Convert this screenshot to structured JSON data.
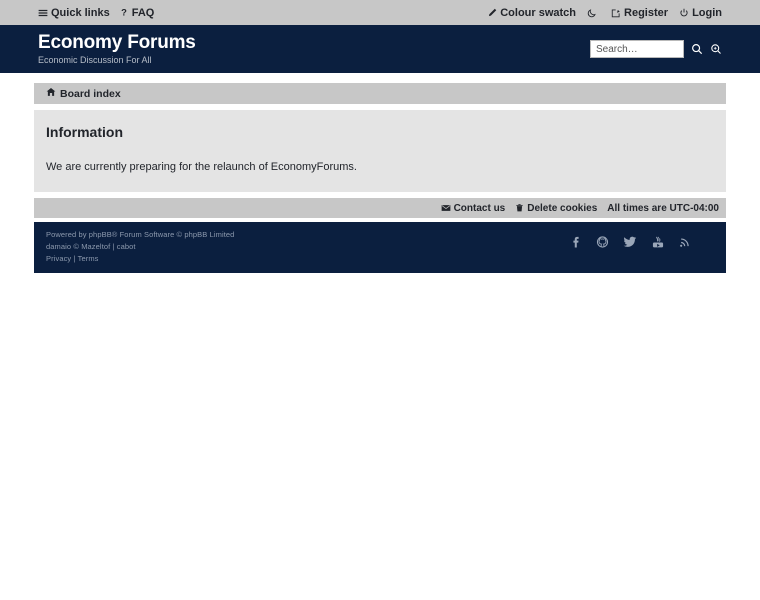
{
  "topnav": {
    "left": [
      {
        "label": "Quick links",
        "icon": "hamburger-icon",
        "name": "quick-links"
      },
      {
        "label": "FAQ",
        "icon": "question-icon",
        "name": "faq"
      }
    ],
    "right": [
      {
        "label": "Colour swatch",
        "icon": "pencil-icon",
        "name": "colour-swatch"
      },
      {
        "label": "",
        "icon": "moon-icon",
        "name": "dark-mode-toggle"
      },
      {
        "label": "Register",
        "icon": "register-icon",
        "name": "register"
      },
      {
        "label": "Login",
        "icon": "power-icon",
        "name": "login"
      }
    ]
  },
  "header": {
    "site_title": "Economy Forums",
    "site_description": "Economic Discussion For All",
    "search": {
      "placeholder": "Search…",
      "value": "",
      "submit_icon": "search-icon",
      "advanced_icon": "advanced-search-icon"
    }
  },
  "breadcrumb": {
    "items": [
      {
        "label": "Board index",
        "icon": "home-icon"
      }
    ]
  },
  "panel": {
    "title": "Information",
    "message": "We are currently preparing for the relaunch of EconomyForums."
  },
  "actionbar": {
    "items": [
      {
        "label": "Contact us",
        "icon": "envelope-icon",
        "name": "contact-us"
      },
      {
        "label": "Delete cookies",
        "icon": "trash-icon",
        "name": "delete-cookies"
      }
    ],
    "timezone": "All times are UTC-04:00"
  },
  "footer": {
    "credits": [
      "Powered by phpBB® Forum Software © phpBB Limited",
      "damaio © Mazeltof | cabot"
    ],
    "legal": {
      "privacy": "Privacy",
      "separator": "|",
      "terms": "Terms"
    },
    "social": [
      {
        "name": "facebook-icon"
      },
      {
        "name": "github-icon"
      },
      {
        "name": "twitter-icon"
      },
      {
        "name": "youtube-icon"
      },
      {
        "name": "rss-icon"
      }
    ]
  },
  "colors": {
    "page_background": "#ffffff",
    "bar_gray": "#c7c7c7",
    "navy": "#0b1f3f",
    "panel_gray": "#e4e4e4",
    "text_dark": "#22252b",
    "muted_footer_text": "#8c99ad"
  }
}
